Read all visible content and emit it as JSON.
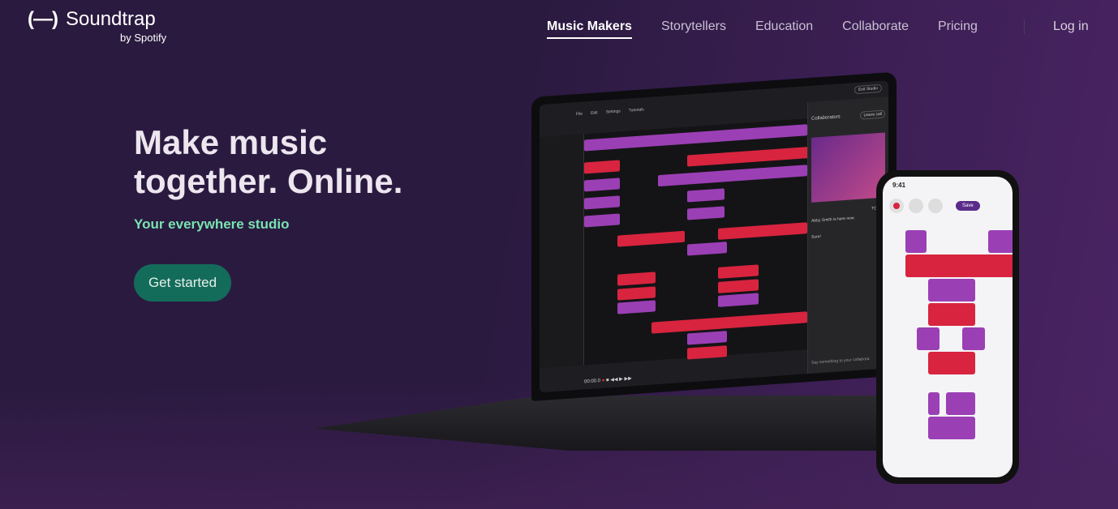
{
  "brand": {
    "name": "Soundtrap",
    "sub": "by Spotify",
    "mark": "(—)"
  },
  "nav": {
    "items": [
      "Music Makers",
      "Storytellers",
      "Education",
      "Collaborate",
      "Pricing"
    ],
    "active": "Music Makers",
    "login": "Log in"
  },
  "hero": {
    "title": "Make music together. Online.",
    "tagline": "Your everywhere studio",
    "cta": "Get started"
  },
  "studio": {
    "menu": [
      "File",
      "Edit",
      "Settings",
      "Tutorials"
    ],
    "exit": "Exit Studio",
    "collaborators": "Collaborators",
    "leave_call": "Leave call",
    "time": "00:00.0",
    "chat_placeholder": "Say something to your collabora",
    "chat_today": "TODAY",
    "chat_msg": "Abby Smith is here now.",
    "chat_reply": "Sure!"
  },
  "phone": {
    "time": "9:41",
    "save": "Save"
  },
  "colors": {
    "bg": "#2a1a3f",
    "accent_green": "#79e3b0",
    "cta": "#136c5a",
    "clip_purple": "#9b3fb5",
    "clip_red": "#d8243f"
  }
}
